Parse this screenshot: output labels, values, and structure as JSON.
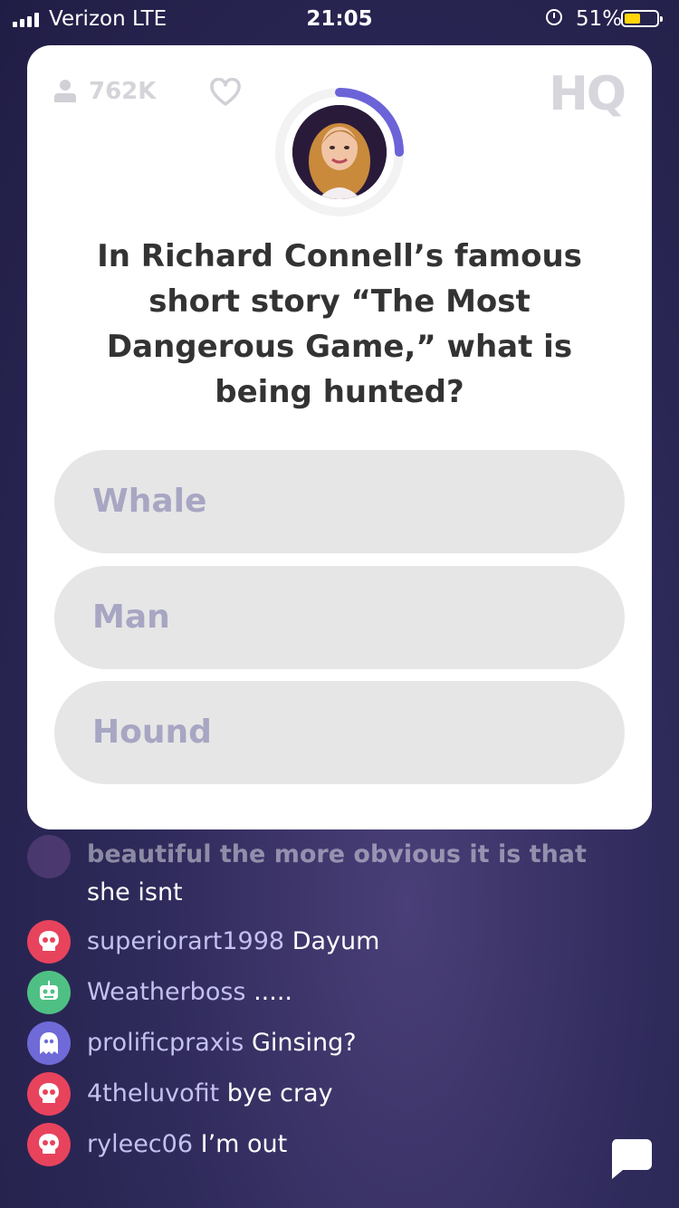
{
  "status_bar": {
    "carrier": "Verizon  LTE",
    "time": "21:05",
    "battery_percent": "51%",
    "battery_level": 0.51,
    "icons": [
      "signal-icon",
      "alarm-icon",
      "battery-icon"
    ]
  },
  "card": {
    "viewer_count": "762K",
    "logo_text": "HQ",
    "timer_progress": 0.25,
    "question": "In Richard Connell’s famous short story “The Most Dangerous Game,” what is being hunted?",
    "answers": [
      {
        "label": "Whale"
      },
      {
        "label": "Man"
      },
      {
        "label": "Hound"
      }
    ]
  },
  "chat": {
    "partial_message": {
      "faded_text": "beautiful the more obvious it is that",
      "continued_text": "she isnt"
    },
    "messages": [
      {
        "username": "superiorart1998",
        "text": "Dayum",
        "avatar_color": "#e8435d",
        "avatar_icon": "skull-icon"
      },
      {
        "username": "Weatherboss",
        "text": ".....",
        "avatar_color": "#4fc083",
        "avatar_icon": "robot-icon"
      },
      {
        "username": "prolificpraxis",
        "text": "Ginsing?",
        "avatar_color": "#6f6ad8",
        "avatar_icon": "ghost-icon"
      },
      {
        "username": "4theluvofit",
        "text": "bye cray",
        "avatar_color": "#e8435d",
        "avatar_icon": "skull-icon"
      },
      {
        "username": "ryleec06",
        "text": "I’m out",
        "avatar_color": "#e8435d",
        "avatar_icon": "skull-icon"
      }
    ]
  },
  "colors": {
    "accent": "#6c63d8",
    "answer_bg": "#e6e6e6",
    "answer_text": "#a7a6c3",
    "question_text": "#333333"
  }
}
